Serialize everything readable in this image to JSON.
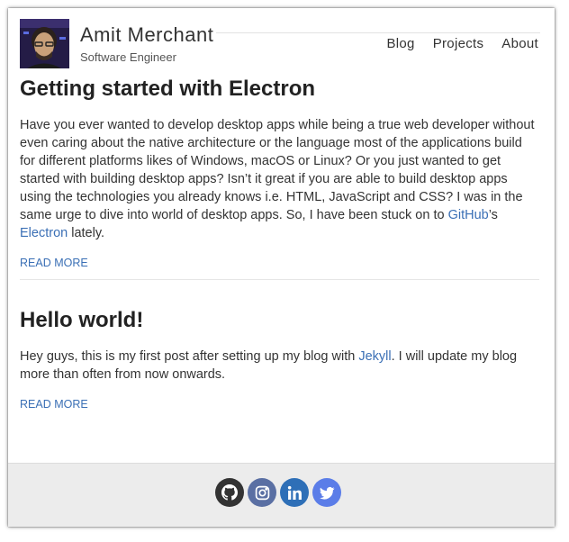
{
  "header": {
    "site_title": "Amit Merchant",
    "tagline": "Software Engineer",
    "nav": [
      "Blog",
      "Projects",
      "About"
    ]
  },
  "posts": [
    {
      "title": "Getting started with Electron",
      "excerpt_before": "Have you ever wanted to develop desktop apps while being a true web developer without even caring about the native architecture or the language most of the applications build for different platforms likes of Windows, macOS or Linux? Or you just wanted to get started with building desktop apps? Isn’t it great if you are able to build desktop apps using the technologies you already knows i.e. HTML, JavaScript and CSS? I was in the same urge to dive into world of desktop apps. So, I have been stuck on to ",
      "link1": "GitHub",
      "between": "’s ",
      "link2": "Electron",
      "after": " lately.",
      "read_more": "READ MORE"
    },
    {
      "title": "Hello world!",
      "excerpt_before": "Hey guys, this is my first post after setting up my blog with ",
      "link1": "Jekyll",
      "after": ". I will update my blog more than often from now onwards.",
      "read_more": "READ MORE"
    }
  ],
  "footer": {
    "social": [
      {
        "icon": "github-icon",
        "color": "#333333"
      },
      {
        "icon": "instagram-icon",
        "color": "#5a6fa3"
      },
      {
        "icon": "linkedin-icon",
        "color": "#2e6fb7"
      },
      {
        "icon": "twitter-icon",
        "color": "#5b7de8"
      }
    ]
  }
}
